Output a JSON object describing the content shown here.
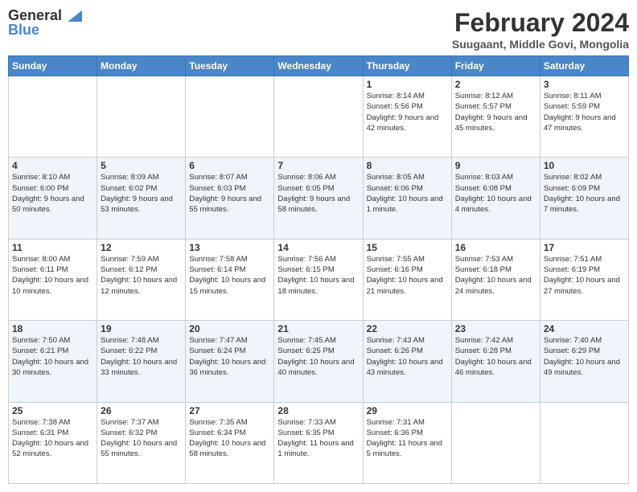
{
  "header": {
    "logo_general": "General",
    "logo_blue": "Blue",
    "main_title": "February 2024",
    "subtitle": "Suugaant, Middle Govi, Mongolia"
  },
  "days_of_week": [
    "Sunday",
    "Monday",
    "Tuesday",
    "Wednesday",
    "Thursday",
    "Friday",
    "Saturday"
  ],
  "weeks": [
    [
      {
        "day": "",
        "info": ""
      },
      {
        "day": "",
        "info": ""
      },
      {
        "day": "",
        "info": ""
      },
      {
        "day": "",
        "info": ""
      },
      {
        "day": "1",
        "info": "Sunrise: 8:14 AM\nSunset: 5:56 PM\nDaylight: 9 hours\nand 42 minutes."
      },
      {
        "day": "2",
        "info": "Sunrise: 8:12 AM\nSunset: 5:57 PM\nDaylight: 9 hours\nand 45 minutes."
      },
      {
        "day": "3",
        "info": "Sunrise: 8:11 AM\nSunset: 5:59 PM\nDaylight: 9 hours\nand 47 minutes."
      }
    ],
    [
      {
        "day": "4",
        "info": "Sunrise: 8:10 AM\nSunset: 6:00 PM\nDaylight: 9 hours\nand 50 minutes."
      },
      {
        "day": "5",
        "info": "Sunrise: 8:09 AM\nSunset: 6:02 PM\nDaylight: 9 hours\nand 53 minutes."
      },
      {
        "day": "6",
        "info": "Sunrise: 8:07 AM\nSunset: 6:03 PM\nDaylight: 9 hours\nand 55 minutes."
      },
      {
        "day": "7",
        "info": "Sunrise: 8:06 AM\nSunset: 6:05 PM\nDaylight: 9 hours\nand 58 minutes."
      },
      {
        "day": "8",
        "info": "Sunrise: 8:05 AM\nSunset: 6:06 PM\nDaylight: 10 hours\nand 1 minute."
      },
      {
        "day": "9",
        "info": "Sunrise: 8:03 AM\nSunset: 6:08 PM\nDaylight: 10 hours\nand 4 minutes."
      },
      {
        "day": "10",
        "info": "Sunrise: 8:02 AM\nSunset: 6:09 PM\nDaylight: 10 hours\nand 7 minutes."
      }
    ],
    [
      {
        "day": "11",
        "info": "Sunrise: 8:00 AM\nSunset: 6:11 PM\nDaylight: 10 hours\nand 10 minutes."
      },
      {
        "day": "12",
        "info": "Sunrise: 7:59 AM\nSunset: 6:12 PM\nDaylight: 10 hours\nand 12 minutes."
      },
      {
        "day": "13",
        "info": "Sunrise: 7:58 AM\nSunset: 6:14 PM\nDaylight: 10 hours\nand 15 minutes."
      },
      {
        "day": "14",
        "info": "Sunrise: 7:56 AM\nSunset: 6:15 PM\nDaylight: 10 hours\nand 18 minutes."
      },
      {
        "day": "15",
        "info": "Sunrise: 7:55 AM\nSunset: 6:16 PM\nDaylight: 10 hours\nand 21 minutes."
      },
      {
        "day": "16",
        "info": "Sunrise: 7:53 AM\nSunset: 6:18 PM\nDaylight: 10 hours\nand 24 minutes."
      },
      {
        "day": "17",
        "info": "Sunrise: 7:51 AM\nSunset: 6:19 PM\nDaylight: 10 hours\nand 27 minutes."
      }
    ],
    [
      {
        "day": "18",
        "info": "Sunrise: 7:50 AM\nSunset: 6:21 PM\nDaylight: 10 hours\nand 30 minutes."
      },
      {
        "day": "19",
        "info": "Sunrise: 7:48 AM\nSunset: 6:22 PM\nDaylight: 10 hours\nand 33 minutes."
      },
      {
        "day": "20",
        "info": "Sunrise: 7:47 AM\nSunset: 6:24 PM\nDaylight: 10 hours\nand 36 minutes."
      },
      {
        "day": "21",
        "info": "Sunrise: 7:45 AM\nSunset: 6:25 PM\nDaylight: 10 hours\nand 40 minutes."
      },
      {
        "day": "22",
        "info": "Sunrise: 7:43 AM\nSunset: 6:26 PM\nDaylight: 10 hours\nand 43 minutes."
      },
      {
        "day": "23",
        "info": "Sunrise: 7:42 AM\nSunset: 6:28 PM\nDaylight: 10 hours\nand 46 minutes."
      },
      {
        "day": "24",
        "info": "Sunrise: 7:40 AM\nSunset: 6:29 PM\nDaylight: 10 hours\nand 49 minutes."
      }
    ],
    [
      {
        "day": "25",
        "info": "Sunrise: 7:38 AM\nSunset: 6:31 PM\nDaylight: 10 hours\nand 52 minutes."
      },
      {
        "day": "26",
        "info": "Sunrise: 7:37 AM\nSunset: 6:32 PM\nDaylight: 10 hours\nand 55 minutes."
      },
      {
        "day": "27",
        "info": "Sunrise: 7:35 AM\nSunset: 6:34 PM\nDaylight: 10 hours\nand 58 minutes."
      },
      {
        "day": "28",
        "info": "Sunrise: 7:33 AM\nSunset: 6:35 PM\nDaylight: 11 hours\nand 1 minute."
      },
      {
        "day": "29",
        "info": "Sunrise: 7:31 AM\nSunset: 6:36 PM\nDaylight: 11 hours\nand 5 minutes."
      },
      {
        "day": "",
        "info": ""
      },
      {
        "day": "",
        "info": ""
      }
    ]
  ]
}
